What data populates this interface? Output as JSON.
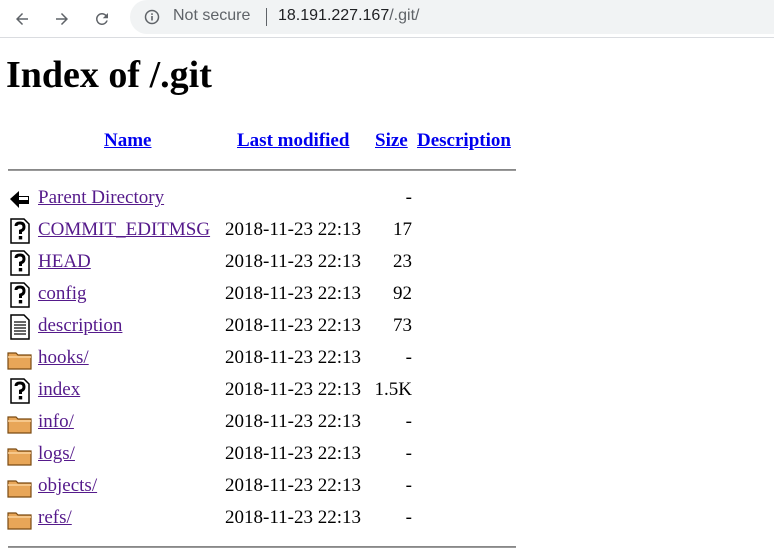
{
  "browser": {
    "security_label": "Not secure",
    "url_host": "18.191.227.167",
    "url_path": "/.git/",
    "icons": [
      "back-arrow-icon",
      "forward-arrow-icon",
      "reload-icon",
      "info-icon"
    ]
  },
  "page": {
    "title": "Index of /.git",
    "columns": {
      "name": "Name",
      "last_modified": "Last modified",
      "size": "Size",
      "description": "Description"
    },
    "rows": [
      {
        "icon": "back-icon",
        "name": "Parent Directory",
        "date": "",
        "size": "-"
      },
      {
        "icon": "unknown-file-icon",
        "name": "COMMIT_EDITMSG",
        "date": "2018-11-23 22:13",
        "size": "17"
      },
      {
        "icon": "unknown-file-icon",
        "name": "HEAD",
        "date": "2018-11-23 22:13",
        "size": "23"
      },
      {
        "icon": "unknown-file-icon",
        "name": "config",
        "date": "2018-11-23 22:13",
        "size": "92"
      },
      {
        "icon": "text-file-icon",
        "name": "description",
        "date": "2018-11-23 22:13",
        "size": "73"
      },
      {
        "icon": "folder-icon",
        "name": "hooks/",
        "date": "2018-11-23 22:13",
        "size": "-"
      },
      {
        "icon": "unknown-file-icon",
        "name": "index",
        "date": "2018-11-23 22:13",
        "size": "1.5K"
      },
      {
        "icon": "folder-icon",
        "name": "info/",
        "date": "2018-11-23 22:13",
        "size": "-"
      },
      {
        "icon": "folder-icon",
        "name": "logs/",
        "date": "2018-11-23 22:13",
        "size": "-"
      },
      {
        "icon": "folder-icon",
        "name": "objects/",
        "date": "2018-11-23 22:13",
        "size": "-"
      },
      {
        "icon": "folder-icon",
        "name": "refs/",
        "date": "2018-11-23 22:13",
        "size": "-"
      }
    ]
  },
  "colors": {
    "link": "#0000ee",
    "visited_link": "#551a8b",
    "omnibox_bg": "#f1f3f4"
  }
}
